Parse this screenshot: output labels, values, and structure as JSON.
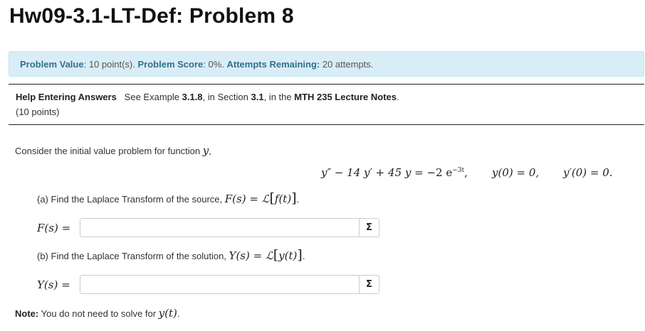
{
  "page": {
    "title": "Hw09-3.1-LT-Def: Problem 8"
  },
  "info": {
    "value_label": "Problem Value",
    "value_text": ": 10 point(s).",
    "score_label": "Problem Score",
    "score_text": ": 0%.",
    "attempts_label": "Attempts Remaining:",
    "attempts_text": "20 attempts."
  },
  "help": {
    "link_label": "Help Entering Answers",
    "text_before": "See Example",
    "example": "3.1.8",
    "text_mid": ", in Section",
    "section": "3.1",
    "text_mid2": ", in the",
    "notes": "MTH 235 Lecture Notes",
    "text_end": ".",
    "points": "(10 points)"
  },
  "problem": {
    "intro": "Consider the initial value problem for function",
    "intro_var": "y",
    "intro_end": ",",
    "equation": {
      "ode_lhs": "y″ − 14 y′ + 45 y",
      "ode_eq": " = −2 e",
      "ode_exp": "−3t",
      "ode_end": ",",
      "ic1": "y(0) = 0,",
      "ic2": "y′(0) = 0."
    },
    "part_a": {
      "text": "(a) Find the Laplace Transform of the source,",
      "math": "F(s) = ℒ",
      "inner": "f(t)",
      "end": ".",
      "label": "F(s) =",
      "value": "",
      "button": "Σ"
    },
    "part_b": {
      "text": "(b) Find the Laplace Transform of the solution,",
      "math": "Y(s) = ℒ",
      "inner": "y(t)",
      "end": ".",
      "label": "Y(s) =",
      "value": "",
      "button": "Σ"
    },
    "note": {
      "label": "Note:",
      "text": "You do not need to solve for",
      "var": "y(t)",
      "end": "."
    }
  },
  "colors": {
    "info_bg": "#d9edf7",
    "info_border": "#bce8f1",
    "info_label": "#31708f"
  }
}
